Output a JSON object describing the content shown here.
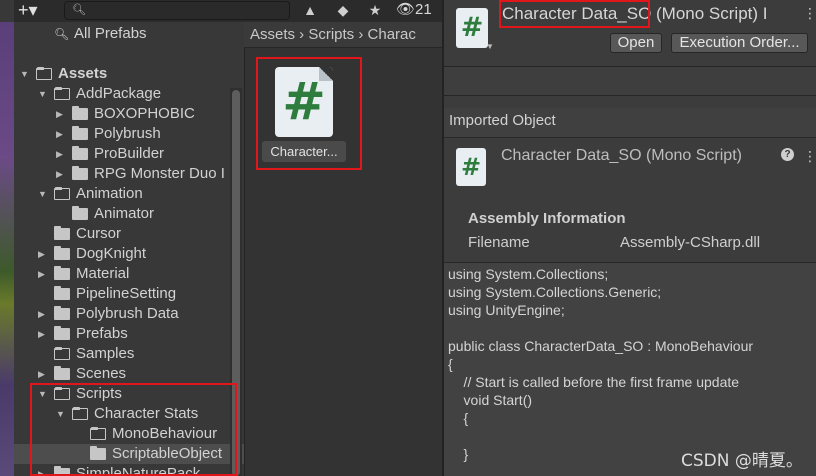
{
  "toolbar": {
    "add_label": "+▾",
    "search_icon": "search-icon",
    "search_placeholder": "",
    "hidden_count": "21"
  },
  "tree": {
    "all_prefabs": "All Prefabs",
    "items": [
      {
        "label": "Assets",
        "bold": true,
        "expanded": true
      },
      {
        "label": "AddPackage",
        "expanded": true
      },
      {
        "label": "BOXOPHOBIC"
      },
      {
        "label": "Polybrush"
      },
      {
        "label": "ProBuilder"
      },
      {
        "label": "RPG Monster Duo I"
      },
      {
        "label": "Animation",
        "expanded": true
      },
      {
        "label": "Animator"
      },
      {
        "label": "Cursor"
      },
      {
        "label": "DogKnight"
      },
      {
        "label": "Material"
      },
      {
        "label": "PipelineSetting"
      },
      {
        "label": "Polybrush Data"
      },
      {
        "label": "Prefabs"
      },
      {
        "label": "Samples"
      },
      {
        "label": "Scenes"
      },
      {
        "label": "Scripts",
        "expanded": true
      },
      {
        "label": "Character Stats",
        "expanded": true
      },
      {
        "label": "MonoBehaviour"
      },
      {
        "label": "ScriptableObject",
        "selected": true
      },
      {
        "label": "SimpleNaturePack"
      }
    ]
  },
  "project": {
    "breadcrumb": "Assets  ›  Scripts  ›  Charac",
    "asset_icon": "#",
    "asset_name": "Character..."
  },
  "inspector": {
    "title_highlight": "Character Data_SO",
    "title_rest": " (Mono Script) I",
    "open_button": "Open",
    "exec_button": "Execution Order...",
    "imported_object": "Imported Object",
    "object_title": "Character Data_SO (Mono Script)",
    "help_glyph": "?",
    "assembly_heading": "Assembly Information",
    "filename_label": "Filename",
    "filename_value": "Assembly-CSharp.dll",
    "code": "using System.Collections;\nusing System.Collections.Generic;\nusing UnityEngine;\n\npublic class CharacterData_SO : MonoBehaviour\n{\n    // Start is called before the first frame update\n    void Start()\n    {\n\n    }"
  },
  "watermark": "CSDN @晴夏。",
  "colors": {
    "annotation_red": "#e0161b",
    "script_green": "#2f7d3e"
  }
}
